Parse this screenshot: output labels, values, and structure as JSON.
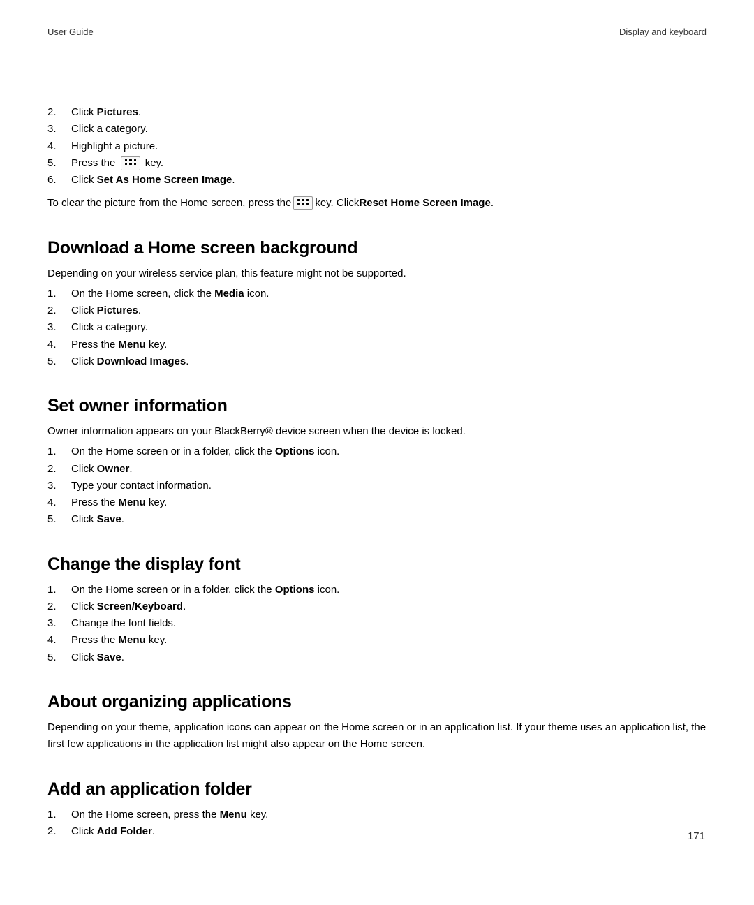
{
  "header": {
    "left": "User Guide",
    "right": "Display and keyboard"
  },
  "initial_list": {
    "start": 2,
    "items": [
      {
        "num": "2.",
        "prefix": "Click ",
        "bold": "Pictures",
        "suffix": "."
      },
      {
        "num": "3.",
        "prefix": "Click a category.",
        "bold": "",
        "suffix": ""
      },
      {
        "num": "4.",
        "prefix": "Highlight a picture.",
        "bold": "",
        "suffix": ""
      },
      {
        "num": "5.",
        "prefix": "Press the ",
        "icon": true,
        "suffix": " key."
      },
      {
        "num": "6.",
        "prefix": "Click ",
        "bold": "Set As Home Screen Image",
        "suffix": "."
      }
    ]
  },
  "clear_para": {
    "p1": "To clear the picture from the Home screen, press the ",
    "p2": " key. Click ",
    "bold": "Reset Home Screen Image",
    "p3": "."
  },
  "sections": {
    "download": {
      "heading": "Download a Home screen background",
      "intro": "Depending on your wireless service plan, this feature might not be supported.",
      "items": [
        {
          "num": "1.",
          "prefix": "On the Home screen, click the ",
          "bold": "Media",
          "suffix": " icon."
        },
        {
          "num": "2.",
          "prefix": "Click ",
          "bold": "Pictures",
          "suffix": "."
        },
        {
          "num": "3.",
          "prefix": "Click a category.",
          "bold": "",
          "suffix": ""
        },
        {
          "num": "4.",
          "prefix": "Press the ",
          "bold": "Menu",
          "suffix": " key."
        },
        {
          "num": "5.",
          "prefix": "Click ",
          "bold": "Download Images",
          "suffix": "."
        }
      ]
    },
    "owner": {
      "heading": "Set owner information",
      "intro": "Owner information appears on your BlackBerry® device screen when the device is locked.",
      "items": [
        {
          "num": "1.",
          "prefix": "On the Home screen or in a folder, click the ",
          "bold": "Options",
          "suffix": " icon."
        },
        {
          "num": "2.",
          "prefix": "Click ",
          "bold": "Owner",
          "suffix": "."
        },
        {
          "num": "3.",
          "prefix": "Type your contact information.",
          "bold": "",
          "suffix": ""
        },
        {
          "num": "4.",
          "prefix": "Press the ",
          "bold": "Menu",
          "suffix": " key."
        },
        {
          "num": "5.",
          "prefix": "Click ",
          "bold": "Save",
          "suffix": "."
        }
      ]
    },
    "font": {
      "heading": "Change the display font",
      "items": [
        {
          "num": "1.",
          "prefix": "On the Home screen or in a folder, click the ",
          "bold": "Options",
          "suffix": " icon."
        },
        {
          "num": "2.",
          "prefix": "Click ",
          "bold": "Screen/Keyboard",
          "suffix": "."
        },
        {
          "num": "3.",
          "prefix": "Change the font fields.",
          "bold": "",
          "suffix": ""
        },
        {
          "num": "4.",
          "prefix": "Press the ",
          "bold": "Menu",
          "suffix": " key."
        },
        {
          "num": "5.",
          "prefix": "Click ",
          "bold": "Save",
          "suffix": "."
        }
      ]
    },
    "organize": {
      "heading": "About organizing applications",
      "body": "Depending on your theme, application icons can appear on the Home screen or in an application list. If your theme uses an application list, the first few applications in the application list might also appear on the Home screen."
    },
    "addfolder": {
      "heading": "Add an application folder",
      "items": [
        {
          "num": "1.",
          "prefix": "On the Home screen, press the ",
          "bold": "Menu",
          "suffix": " key."
        },
        {
          "num": "2.",
          "prefix": "Click ",
          "bold": "Add Folder",
          "suffix": "."
        }
      ]
    }
  },
  "page_number": "171"
}
